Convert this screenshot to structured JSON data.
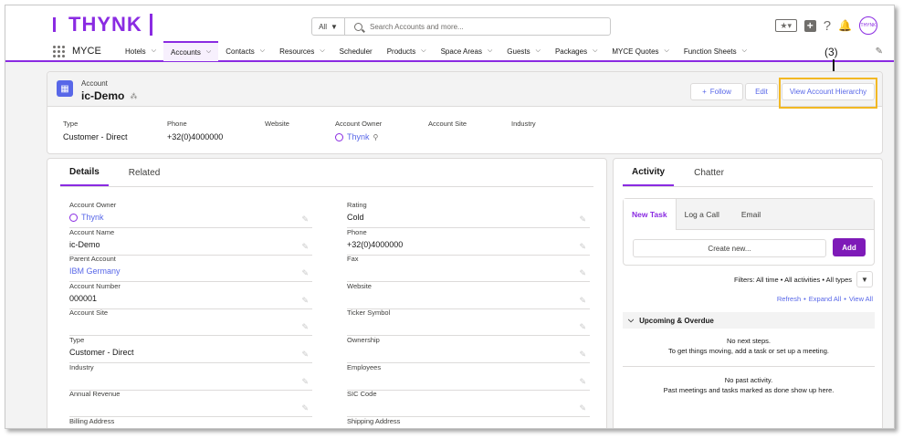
{
  "header": {
    "logo_text": "THYNK",
    "search_scope": "All",
    "search_placeholder": "Search Accounts and more...",
    "avatar_text": "THYNK"
  },
  "nav": {
    "app_name": "MYCE",
    "items": [
      {
        "label": "Hotels"
      },
      {
        "label": "Accounts"
      },
      {
        "label": "Contacts"
      },
      {
        "label": "Resources"
      },
      {
        "label": "Scheduler"
      },
      {
        "label": "Products"
      },
      {
        "label": "Space Areas"
      },
      {
        "label": "Guests"
      },
      {
        "label": "Packages"
      },
      {
        "label": "MYCE Quotes"
      },
      {
        "label": "Function Sheets"
      }
    ]
  },
  "record": {
    "object_type": "Account",
    "name": "ic-Demo",
    "follow_label": "Follow",
    "edit_label": "Edit",
    "hierarchy_label": "View Account Hierarchy",
    "callout": "(3)",
    "facets": [
      {
        "label": "Type",
        "value": "Customer - Direct"
      },
      {
        "label": "Phone",
        "value": "+32(0)4000000"
      },
      {
        "label": "Website",
        "value": ""
      },
      {
        "label": "Account Owner",
        "value": "Thynk"
      },
      {
        "label": "Account Site",
        "value": ""
      },
      {
        "label": "Industry",
        "value": ""
      }
    ]
  },
  "details": {
    "tabs": [
      "Details",
      "Related"
    ],
    "left_fields": [
      {
        "label": "Account Owner",
        "value": "Thynk"
      },
      {
        "label": "Account Name",
        "value": "ic-Demo"
      },
      {
        "label": "Parent Account",
        "value": "IBM Germany"
      },
      {
        "label": "Account Number",
        "value": "000001"
      },
      {
        "label": "Account Site",
        "value": ""
      },
      {
        "label": "Type",
        "value": "Customer - Direct"
      },
      {
        "label": "Industry",
        "value": ""
      },
      {
        "label": "Annual Revenue",
        "value": ""
      },
      {
        "label": "Billing Address",
        "value": ""
      }
    ],
    "right_fields": [
      {
        "label": "Rating",
        "value": "Cold"
      },
      {
        "label": "Phone",
        "value": "+32(0)4000000"
      },
      {
        "label": "Fax",
        "value": ""
      },
      {
        "label": "Website",
        "value": ""
      },
      {
        "label": "Ticker Symbol",
        "value": ""
      },
      {
        "label": "Ownership",
        "value": ""
      },
      {
        "label": "Employees",
        "value": ""
      },
      {
        "label": "SIC Code",
        "value": ""
      },
      {
        "label": "Shipping Address",
        "value": ""
      }
    ]
  },
  "activity": {
    "tabs": [
      "Activity",
      "Chatter"
    ],
    "composer_tabs": [
      "New Task",
      "Log a Call",
      "Email"
    ],
    "create_placeholder": "Create new...",
    "add_label": "Add",
    "filters_text": "Filters: All time • All activities • All types",
    "refresh": "Refresh",
    "expand_all": "Expand All",
    "view_all": "View All",
    "upcoming_title": "Upcoming & Overdue",
    "no_next_title": "No next steps.",
    "no_next_body": "To get things moving, add a task or set up a meeting.",
    "no_past_title": "No past activity.",
    "no_past_body": "Past meetings and tasks marked as done show up here."
  }
}
